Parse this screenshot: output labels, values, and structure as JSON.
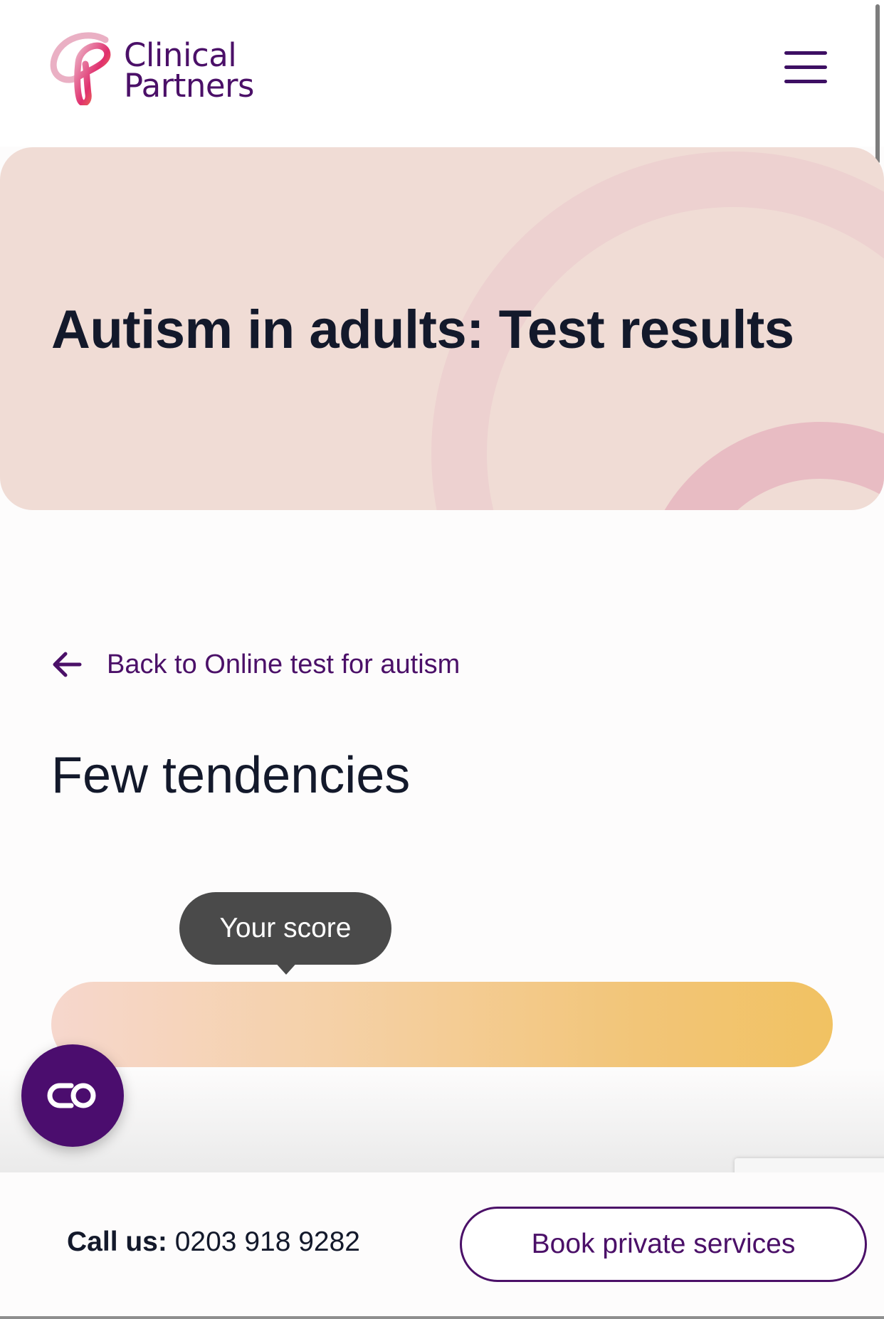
{
  "brand": {
    "logo_line1": "Clinical",
    "logo_line2": "Partners",
    "logo_icon": "clinical-partners-logo-mark",
    "primary_color": "#4b1068",
    "logo_gradient": [
      "#e9a7c0",
      "#e0306e",
      "#f3a13a"
    ]
  },
  "header": {
    "menu_icon": "hamburger-menu-icon"
  },
  "hero": {
    "title": "Autism in adults: Test results",
    "background_color": "#f0dcd5"
  },
  "navigation": {
    "back_label": "Back to Online test for autism",
    "back_icon": "arrow-left-icon"
  },
  "result": {
    "title": "Few tendencies",
    "tooltip": "Your score",
    "bar_gradient": [
      "#f6d7cd",
      "#f1c262"
    ]
  },
  "chat": {
    "icon": "chat-widget-icon",
    "color": "#4b0d6e"
  },
  "footer": {
    "call_label": "Call us:",
    "phone": "0203 918 9282",
    "book_button": "Book private services"
  }
}
